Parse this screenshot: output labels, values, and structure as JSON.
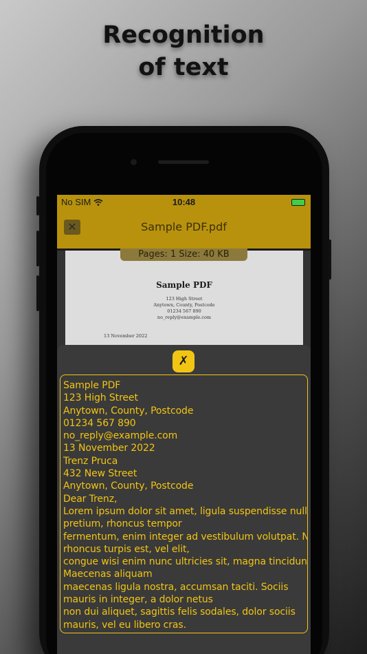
{
  "headline": {
    "line1": "Recognition",
    "line2": "of text"
  },
  "status_bar": {
    "carrier": "No SIM",
    "time": "10:48",
    "wifi_icon": "wifi-icon",
    "battery_icon": "battery-charging-icon"
  },
  "nav": {
    "close_icon": "close-icon",
    "title": "Sample PDF.pdf"
  },
  "file_info": {
    "pages": "Pages: 1   Size: 40 KB"
  },
  "document_preview": {
    "title": "Sample PDF",
    "address_lines": [
      "123 High Street",
      "Anytown, County, Postcode",
      "01234 567 890",
      "no_reply@example.com"
    ],
    "date": "13 November 2022"
  },
  "sheet": {
    "dismiss_icon": "x-mark-icon",
    "dismiss_label": "✗"
  },
  "recognized_text": [
    "Sample PDF",
    "123 High Street",
    "Anytown, County, Postcode",
    "01234 567 890",
    "no_reply@example.com",
    "13 November 2022",
    "Trenz Pruca",
    "432 New Street",
    "Anytown, County, Postcode",
    "Dear Trenz,",
    "Lorem ipsum dolor sit amet, ligula suspendisse nulla",
    "pretium, rhoncus tempor",
    "fermentum, enim integer ad vestibulum volutpat. Nisl",
    "rhoncus turpis est, vel elit,",
    "congue wisi enim nunc ultricies sit, magna tincidunt.",
    "Maecenas aliquam",
    "maecenas ligula nostra, accumsan taciti. Sociis",
    "mauris in integer, a dolor netus",
    "non dui aliquet, sagittis felis sodales, dolor sociis",
    "mauris, vel eu libero cras."
  ],
  "colors": {
    "accent": "#f2c514",
    "nav_background": "#b8920d",
    "sheet_background": "#3a3a3a"
  }
}
